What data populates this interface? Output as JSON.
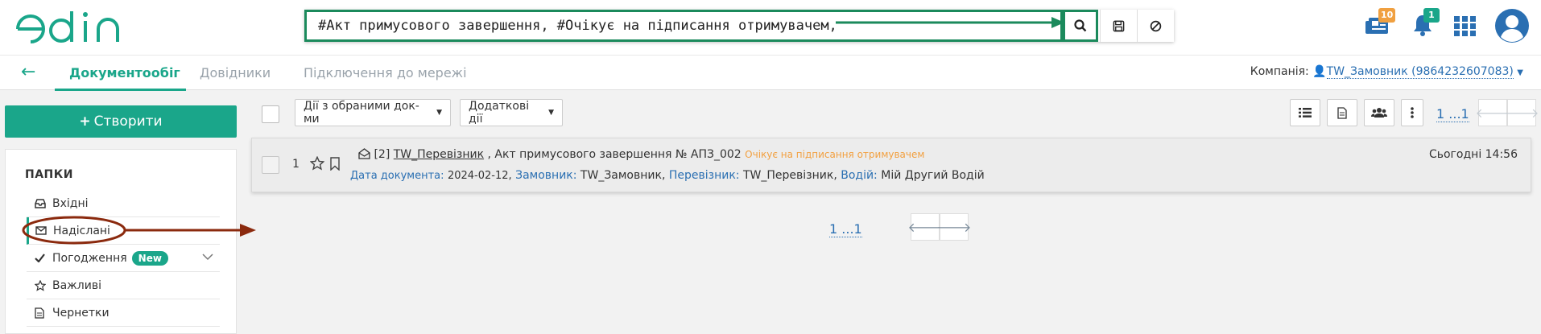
{
  "app": {
    "logo": "edin"
  },
  "search": {
    "value": "#Акт примусового завершення, #Очікує на підписання отримувачем,"
  },
  "top_icons": {
    "news_count": "10",
    "notify_count": "1"
  },
  "nav": {
    "tabs": [
      "Документообіг",
      "Довідники",
      "Підключення до мережі"
    ],
    "company_label": "Компанія:",
    "company_value": "TW_Замовник (9864232607083)"
  },
  "sidebar": {
    "create_label": "Створити",
    "folders_title": "ПАПКИ",
    "items": [
      {
        "label": "Вхідні"
      },
      {
        "label": "Надіслані"
      },
      {
        "label": "Погодження",
        "badge": "New"
      },
      {
        "label": "Важливі"
      },
      {
        "label": "Чернетки"
      }
    ]
  },
  "toolbar": {
    "actions_selected": "Дії з обраними док-ми",
    "extra_actions": "Додаткові дії",
    "pager": "1 ...1"
  },
  "document": {
    "index": "1",
    "code": "[2]",
    "sender": "TW_Перевізник",
    "title": ", Акт примусового завершення № АПЗ_002",
    "status": "Очікує на підписання отримувачем",
    "time": "Сьогодні 14:56",
    "date_label": "Дата документа:",
    "date_value": "2024-02-12,",
    "customer_label": "Замовник:",
    "customer_value": "TW_Замовник,",
    "carrier_label": "Перевізник:",
    "carrier_value": "TW_Перевізник,",
    "driver_label": "Водій:",
    "driver_value": "Мій Другий Водій"
  },
  "bottom_pager": "1 ...1",
  "colors": {
    "accent": "#1aa68a",
    "annotation_green": "#1b8a5c",
    "annotation_red": "#8b2a0e",
    "link": "#2a6fb2",
    "status": "#f2a040"
  }
}
